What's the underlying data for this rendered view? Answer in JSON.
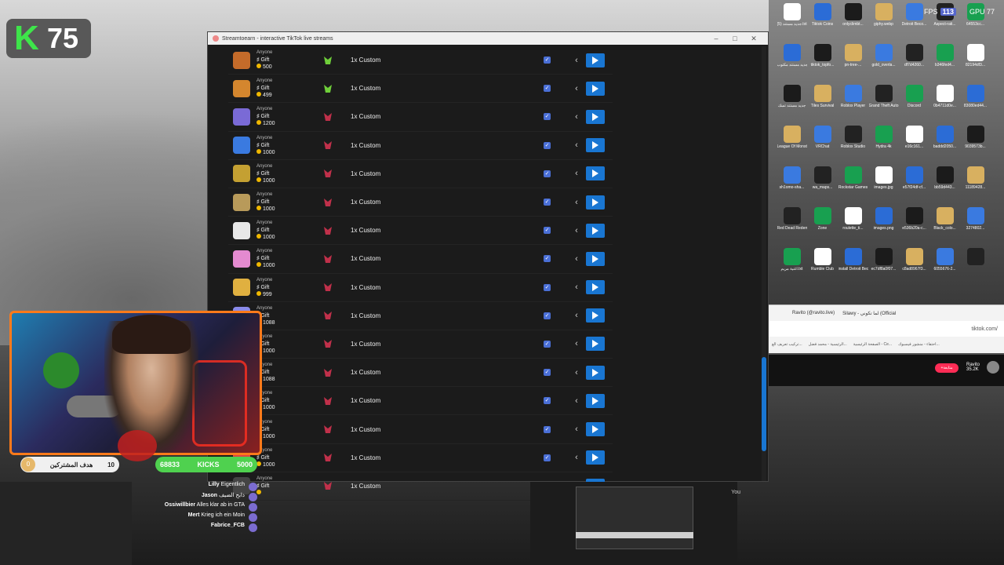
{
  "kick_badge": {
    "count": "75"
  },
  "window": {
    "title": "Streamtoearn - interactive TikTok live streams"
  },
  "gift_rows": [
    {
      "who": "Anyone",
      "type": "Gift",
      "price": "500",
      "action": "1x Custom",
      "img": "#c46b2a",
      "icon": "#6fcf3a"
    },
    {
      "who": "Anyone",
      "type": "Gift",
      "price": "499",
      "action": "1x Custom",
      "img": "#d4862e",
      "icon": "#6fcf3a"
    },
    {
      "who": "Anyone",
      "type": "Gift",
      "price": "1200",
      "action": "1x Custom",
      "img": "#7a6ad6",
      "icon": "#c0304a"
    },
    {
      "who": "Anyone",
      "type": "Gift",
      "price": "1000",
      "action": "1x Custom",
      "img": "#3a7ae0",
      "icon": "#c0304a"
    },
    {
      "who": "Anyone",
      "type": "Gift",
      "price": "1000",
      "action": "1x Custom",
      "img": "#c4a032",
      "icon": "#c0304a"
    },
    {
      "who": "Anyone",
      "type": "Gift",
      "price": "1000",
      "action": "1x Custom",
      "img": "#b89a5a",
      "icon": "#c0304a"
    },
    {
      "who": "Anyone",
      "type": "Gift",
      "price": "1000",
      "action": "1x Custom",
      "img": "#e8e8e8",
      "icon": "#c0304a"
    },
    {
      "who": "Anyone",
      "type": "Gift",
      "price": "1000",
      "action": "1x Custom",
      "img": "#e48ad0",
      "icon": "#c0304a"
    },
    {
      "who": "Anyone",
      "type": "Gift",
      "price": "999",
      "action": "1x Custom",
      "img": "#e0b040",
      "icon": "#c0304a"
    },
    {
      "who": "Anyone",
      "type": "Gift",
      "price": "1088",
      "action": "1x Custom",
      "img": "#8a8ae8",
      "icon": "#c0304a"
    },
    {
      "who": "Anyone",
      "type": "Gift",
      "price": "1000",
      "action": "1x Custom",
      "img": "#444",
      "icon": "#c0304a"
    },
    {
      "who": "Anyone",
      "type": "Gift",
      "price": "1088",
      "action": "1x Custom",
      "img": "#444",
      "icon": "#c0304a"
    },
    {
      "who": "Anyone",
      "type": "Gift",
      "price": "1000",
      "action": "1x Custom",
      "img": "#444",
      "icon": "#c0304a"
    },
    {
      "who": "Anyone",
      "type": "Gift",
      "price": "1000",
      "action": "1x Custom",
      "img": "#444",
      "icon": "#c0304a"
    },
    {
      "who": "Anyone",
      "type": "Gift",
      "price": "1000",
      "action": "1x Custom",
      "img": "#d44",
      "icon": "#c0304a"
    },
    {
      "who": "Anyone",
      "type": "Gift",
      "price": "",
      "action": "1x Custom",
      "img": "#444",
      "icon": "#c0304a"
    }
  ],
  "desktop": {
    "fps_label": "FPS",
    "fps_value": "113",
    "gpu_label": "GPU",
    "gpu_value": "77",
    "icons": [
      [
        "جديد مستند (5).txt",
        "Tiktok Coins",
        "onlyclimbt...",
        "giphy.webp",
        "Detroit Beco...",
        "Aspect-rati...",
        "64553cc..."
      ],
      [
        "جديد مستند مكتوب",
        "tiktok_topfo...",
        "pn-tree-...",
        "gold_overla...",
        "df7d4260...",
        "b346fed4...",
        "82194df3..."
      ],
      [
        "جديد مستند تسك",
        "Tiles Survival",
        "Roblox Player",
        "Grand Theft Auto V",
        "Discord",
        "0b4711d0e...",
        "83080ed44..."
      ],
      [
        "League Of Monster...",
        "VRChat",
        "Roblox Studio",
        "Hydra 4k",
        "e16c161...",
        "baddd2050...",
        "9039573b..."
      ],
      [
        "sh1omo-sha...",
        "wa_maps...",
        "Rockstar Games",
        "images.jpg",
        "e57f24df-cf...",
        "bb59d443...",
        "11189428..."
      ],
      [
        "Red Dead Redemp...",
        "Zone",
        "roulette_ti...",
        "images.png",
        "e536b20a-c...",
        "Black_colo...",
        "3274802..."
      ],
      [
        "اغنية مريم.txt",
        "Rumble Club",
        "install Detroit Become H...",
        "ec7df8a0f07...",
        "c8ad8967f3...",
        "6055676-2...",
        ""
      ]
    ]
  },
  "browser": {
    "tabs": [
      "Ravito (@ravito.live)",
      "Silawy - لما تكوني (Official"
    ],
    "url": "tiktok.com/",
    "bookmarks": [
      "تركيب تعريف الع...",
      "الرئيسية - محمد فضل...",
      "الصفحة الرئيسية - Ce...",
      "احتفاء - منشور فيسبوك..."
    ],
    "follow": "+متابعة",
    "channel_name": "Ravito",
    "channel_followers": "35.2K"
  },
  "overlay": {
    "sub_goal_current": "0",
    "sub_goal_label": "هدف المشتركين",
    "sub_goal_target": "10",
    "kicks_current": "68833",
    "kicks_label": "KICKS",
    "kicks_target": "5000"
  },
  "chat": [
    {
      "user": "Lilly",
      "msg": "Eigentlich"
    },
    {
      "user": "Jason",
      "msg": "ذابح الضيف"
    },
    {
      "user": "Ossiwillbier",
      "msg": "Alles klar ab in GTA"
    },
    {
      "user": "Mert",
      "msg": "Krieg ich ein Moin"
    },
    {
      "user": "Fabrice_FCB",
      "msg": ""
    }
  ],
  "game_label": "You"
}
